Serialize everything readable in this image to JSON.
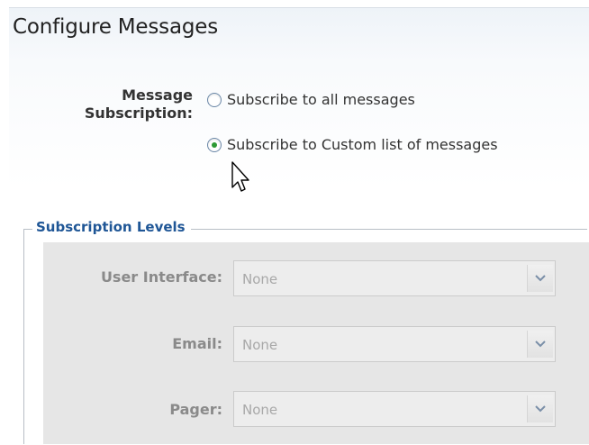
{
  "header": {
    "title": "Configure Messages"
  },
  "subscription": {
    "label": "Message Subscription:",
    "options": [
      {
        "label": "Subscribe to all messages",
        "checked": false
      },
      {
        "label": "Subscribe to Custom list of messages",
        "checked": true
      }
    ]
  },
  "levels": {
    "legend": "Subscription Levels",
    "fields": [
      {
        "label": "User Interface:",
        "value": "None"
      },
      {
        "label": "Email:",
        "value": "None"
      },
      {
        "label": "Pager:",
        "value": "None"
      }
    ]
  },
  "icons": {
    "cursor": "mouse-pointer-icon",
    "dropdown": "chevron-down-icon"
  },
  "colors": {
    "legend": "#1f5696",
    "radio_selected": "#2e9a34",
    "disabled_text": "#8a8a8a"
  }
}
